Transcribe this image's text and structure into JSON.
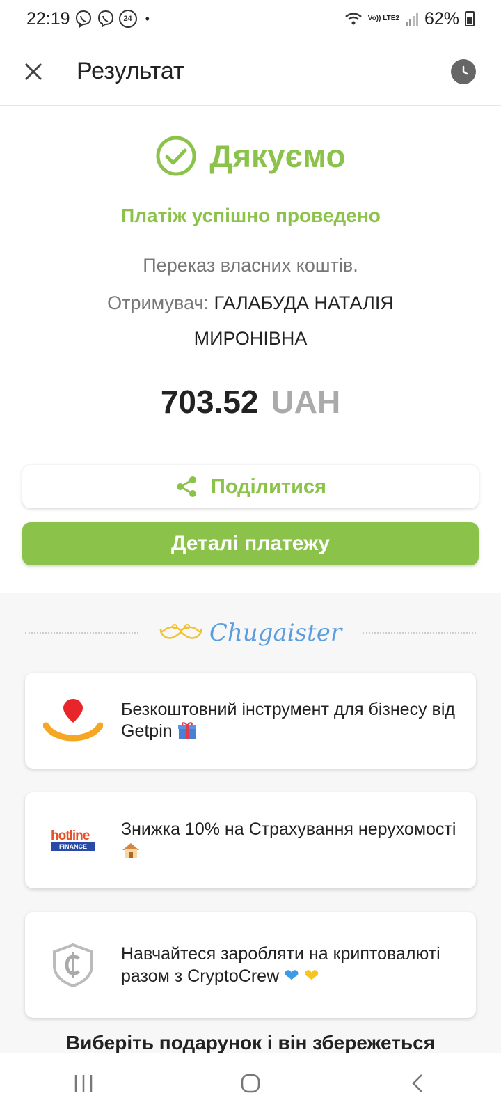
{
  "status_bar": {
    "time": "22:19",
    "badge": "24",
    "lte": "Vo)) LTE2",
    "battery": "62%"
  },
  "app_bar": {
    "title": "Результат"
  },
  "result": {
    "thanks": "Дякуємо",
    "success": "Платіж успішно проведено",
    "transfer": "Переказ власних коштів.",
    "recipient_label": "Отримувач:",
    "recipient_name": "ГАЛАБУДА НАТАЛІЯ МИРОНІВНА",
    "amount": "703.52",
    "currency": "UAH",
    "share_label": "Поділитися",
    "details_label": "Деталі платежу"
  },
  "offers": {
    "brand": "Chugaister",
    "cards": [
      {
        "text": "Безкоштовний інструмент для бізнесу від Getpin",
        "logo": "getpin-logo"
      },
      {
        "text": "Знижка 10% на Страхування нерухомості",
        "logo": "hotline-finance-logo",
        "logo_text": [
          "hotline",
          "FINANCE"
        ]
      },
      {
        "text": "Навчайтеся заробляти на криптовалюті разом з CryptoCrew",
        "logo": "cryptocrew-logo"
      }
    ],
    "gift_cta": "Виберіть подарунок і він збережеться"
  },
  "colors": {
    "accent": "#8bc34a",
    "brand_blue": "#5b9ee0",
    "muted": "#777777"
  }
}
